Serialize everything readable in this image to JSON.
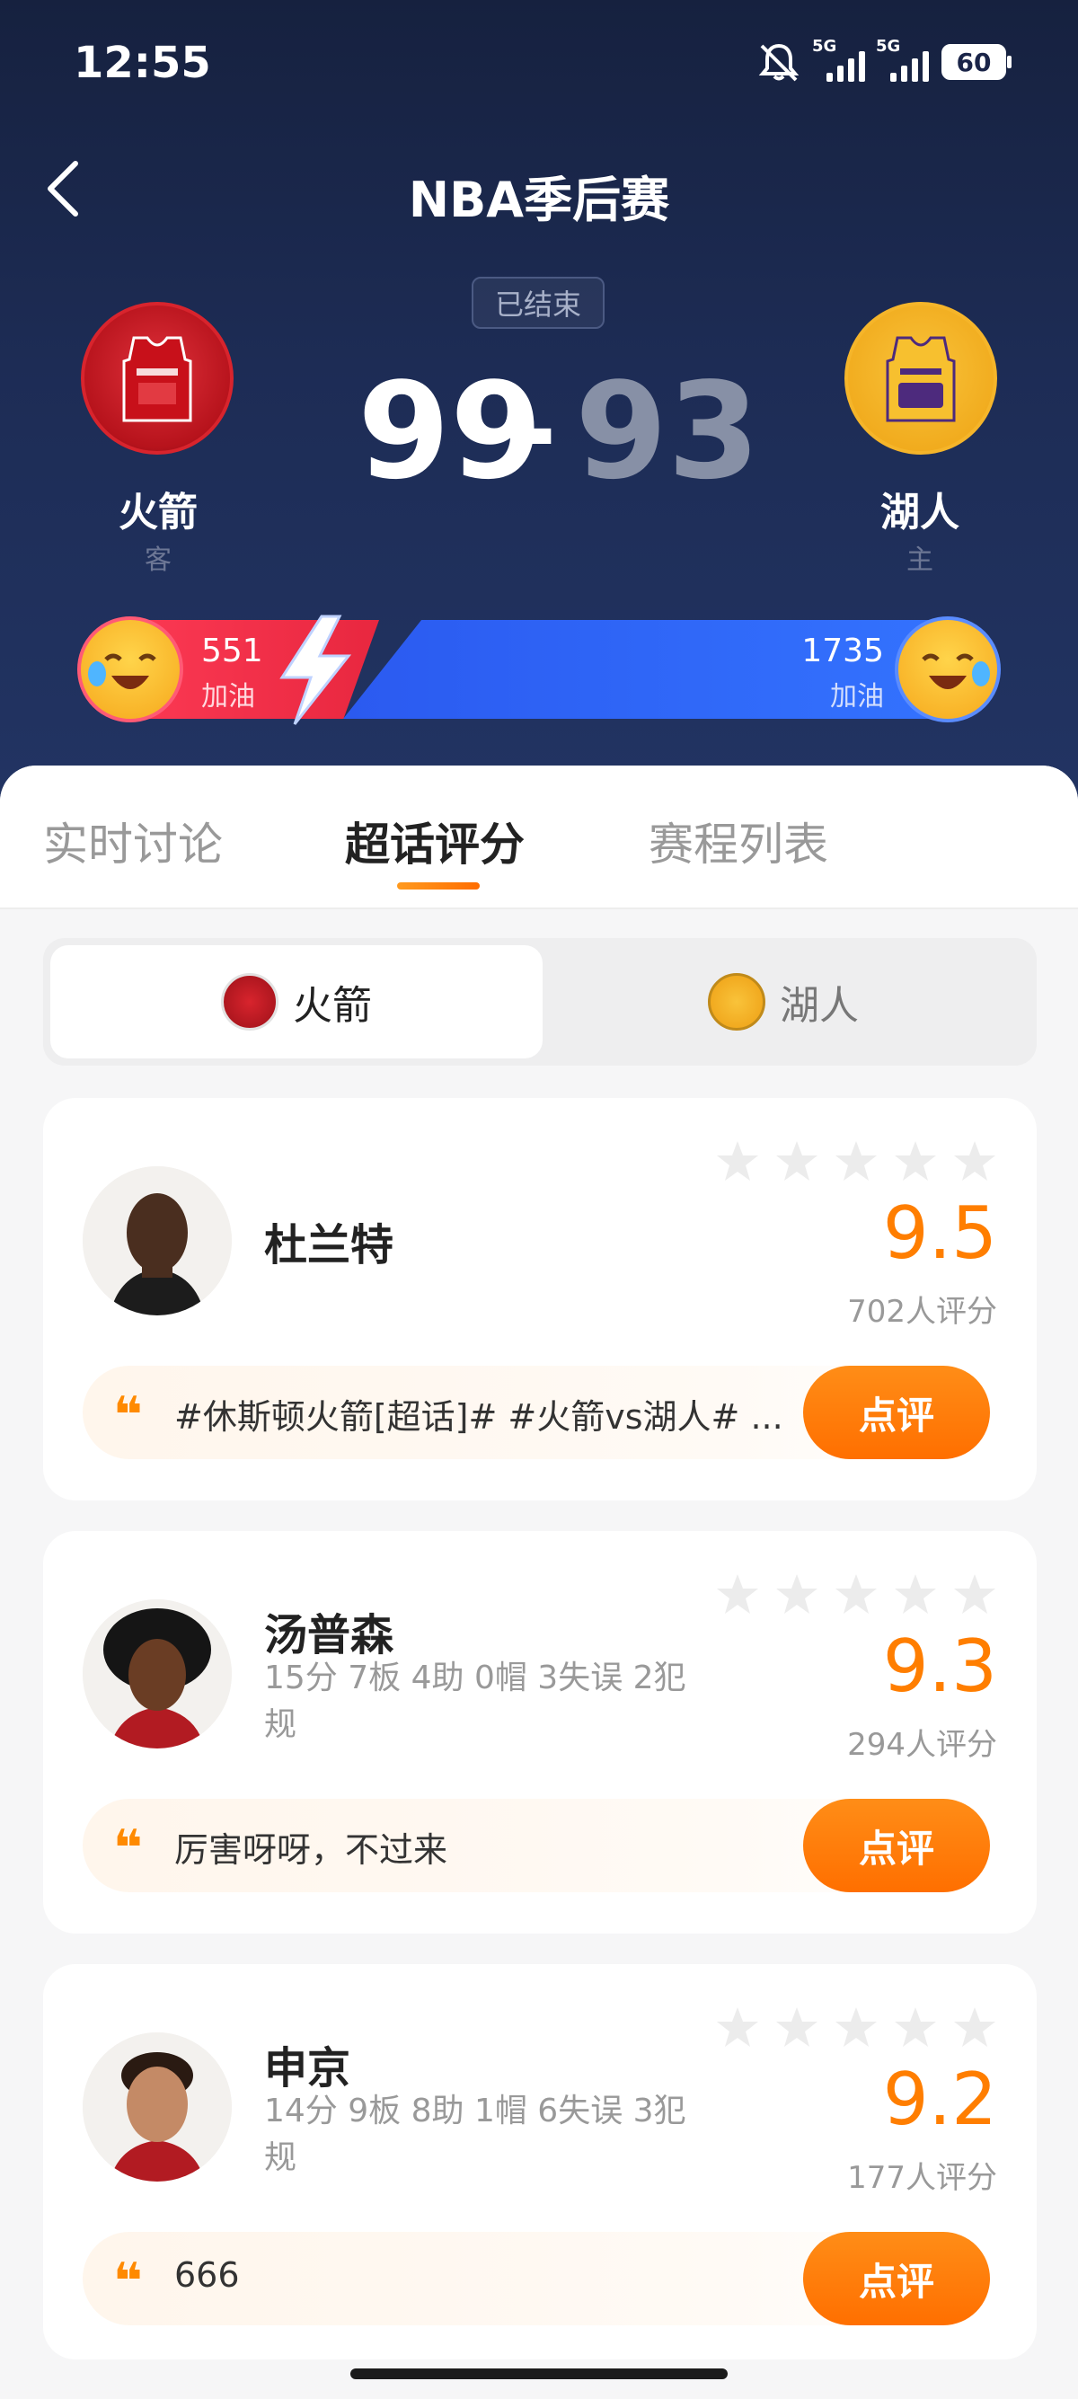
{
  "status_bar": {
    "time": "12:55",
    "net1": "5G",
    "net2": "5G",
    "battery": "60"
  },
  "header": {
    "title": "NBA季后赛",
    "status_badge": "已结束",
    "away_team": {
      "name": "火箭",
      "role": "客",
      "score": "99"
    },
    "home_team": {
      "name": "湖人",
      "role": "主",
      "score": "93"
    },
    "score_separator": "-",
    "cheer": {
      "away_count": "551",
      "away_label": "加油",
      "home_count": "1735",
      "home_label": "加油"
    }
  },
  "tabs": [
    {
      "label": "实时讨论"
    },
    {
      "label": "超话评分"
    },
    {
      "label": "赛程列表"
    }
  ],
  "team_toggle": {
    "away_label": "火箭",
    "home_label": "湖人"
  },
  "players": [
    {
      "name": "杜兰特",
      "stats": "",
      "rating": "9.5",
      "rating_count": "702人评分",
      "comment": "#休斯顿火箭[超话]# #火箭vs湖人# ...",
      "button": "点评"
    },
    {
      "name": "汤普森",
      "stats": "15分 7板 4助 0帽 3失误 2犯规",
      "rating": "9.3",
      "rating_count": "294人评分",
      "comment": "厉害呀呀，不过来",
      "button": "点评"
    },
    {
      "name": "申京",
      "stats": "14分 9板 8助 1帽 6失误 3犯规",
      "rating": "9.2",
      "rating_count": "177人评分",
      "comment": "666",
      "button": "点评"
    }
  ],
  "colors": {
    "accent": "#ff7e00",
    "header_bg": "#1d2c55",
    "away_red": "#e8273f",
    "home_blue": "#3474ff"
  }
}
